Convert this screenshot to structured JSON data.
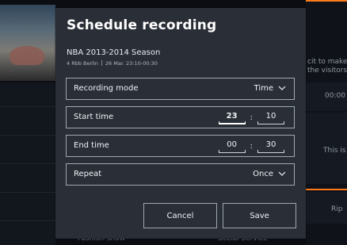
{
  "background": {
    "right_text_1": "cit to make it",
    "right_text_2": "the visitors a",
    "right_time": "00:00",
    "right_text_3": "This is",
    "right_text_4": "Rip",
    "bottom_left": "Fashion show",
    "bottom_right": "Social Service"
  },
  "modal": {
    "title": "Schedule recording",
    "program_title": "NBA 2013-2014 Season",
    "channel": "4 Rbb Berlin",
    "air_time": "26 Mar. 23:10-00:30",
    "rows": {
      "recording_mode": {
        "label": "Recording mode",
        "value": "Time"
      },
      "start_time": {
        "label": "Start time",
        "hours": "23",
        "minutes": "10",
        "separator": ":"
      },
      "end_time": {
        "label": "End time",
        "hours": "00",
        "minutes": "30",
        "separator": ":"
      },
      "repeat": {
        "label": "Repeat",
        "value": "Once"
      }
    },
    "buttons": {
      "cancel": "Cancel",
      "save": "Save"
    }
  },
  "icons": {
    "dropdown": "chevron-down-icon"
  }
}
